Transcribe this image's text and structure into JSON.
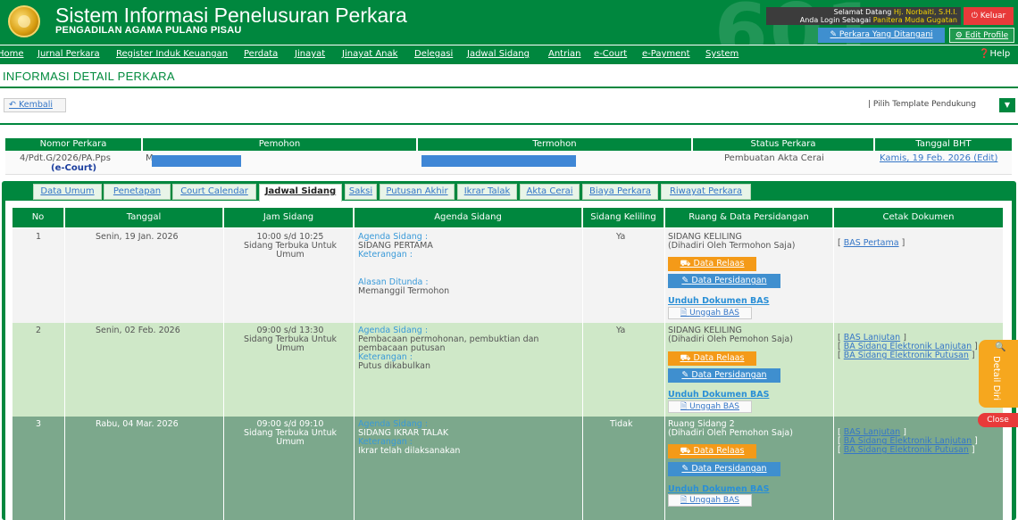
{
  "header": {
    "watermark": "601",
    "title": "Sistem Informasi Penelusuran Perkara",
    "subtitle": "PENGADILAN AGAMA PULANG PISAU",
    "greeting_prefix": "Selamat Datang",
    "user_name": "Hj. Norbaiti, S.H.I.",
    "login_prefix": "Anda Login Sebagai",
    "role": "Panitera Muda Gugatan",
    "logout_label": "Keluar",
    "handled_label": "Perkara Yang Ditangani",
    "edit_profile_label": "Edit Profile"
  },
  "nav": {
    "items": [
      "Home",
      "Jurnal Perkara",
      "Register Induk Keuangan",
      "Perdata",
      "Jinayat",
      "Jinayat Anak",
      "Delegasi",
      "Jadwal Sidang",
      "Antrian",
      "e-Court",
      "e-Payment",
      "System"
    ],
    "help": "Help"
  },
  "page": {
    "title": "INFORMASI DETAIL PERKARA",
    "back_label": "Kembali",
    "template_label": "Pilih Template Pendukung"
  },
  "summary": {
    "headers": [
      "Nomor Perkara",
      "Pemohon",
      "Termohon",
      "Status Perkara",
      "Tanggal BHT"
    ],
    "nomor": "4/Pdt.G/2026/PA.Pps",
    "ecourt": "(e-Court)",
    "pemohon_initial": "M",
    "status": "Pembuatan Akta Cerai",
    "bht": "Kamis, 19 Feb. 2026 (Edit)"
  },
  "tabs": [
    "Data Umum",
    "Penetapan",
    "Court Calendar",
    "Jadwal Sidang",
    "Saksi",
    "Putusan Akhir",
    "Ikrar Talak",
    "Akta Cerai",
    "Biaya Perkara",
    "Riwayat Perkara"
  ],
  "table": {
    "headers": [
      "No",
      "Tanggal",
      "Jam Sidang",
      "Agenda Sidang",
      "Sidang Keliling",
      "Ruang & Data Persidangan",
      "Cetak Dokumen"
    ],
    "agenda_label": "Agenda Sidang :",
    "keterangan_label": "Keterangan :",
    "alasan_label": "Alasan Ditunda :",
    "relaas_label": "Data Relaas",
    "persidangan_label": "Data Persidangan",
    "unduh_label": "Unduh Dokumen BAS",
    "unggah_label": "Unggah BAS",
    "rows": [
      {
        "no": "1",
        "tanggal": "Senin, 19 Jan. 2026",
        "jam": "10:00 s/d 10:25",
        "jam_note": "Sidang Terbuka Untuk Umum",
        "agenda": "SIDANG PERTAMA",
        "keterangan": "",
        "alasan": "Memanggil Termohon",
        "keliling": "Ya",
        "ruang": "SIDANG KELILING",
        "ruang_note": "(Dihadiri Oleh Termohon Saja)",
        "docs": [
          "BAS Pertama"
        ]
      },
      {
        "no": "2",
        "tanggal": "Senin, 02 Feb. 2026",
        "jam": "09:00 s/d 13:30",
        "jam_note": "Sidang Terbuka Untuk Umum",
        "agenda": "Pembacaan permohonan, pembuktian dan pembacaan putusan",
        "keterangan": "Putus dikabulkan",
        "keliling": "Ya",
        "ruang": "SIDANG KELILING",
        "ruang_note": "(Dihadiri Oleh Pemohon Saja)",
        "docs": [
          "BAS Lanjutan",
          "BA Sidang Elektronik Lanjutan",
          "BA Sidang Elektronik Putusan"
        ]
      },
      {
        "no": "3",
        "tanggal": "Rabu, 04 Mar. 2026",
        "jam": "09:00 s/d 09:10",
        "jam_note": "Sidang Terbuka Untuk Umum",
        "agenda": "SIDANG IKRAR TALAK",
        "keterangan": "Ikrar telah dilaksanakan",
        "keliling": "Tidak",
        "ruang": "Ruang Sidang 2",
        "ruang_note": "(Dihadiri Oleh Pemohon Saja)",
        "docs": [
          "BAS Lanjutan",
          "BA Sidang Elektronik Lanjutan",
          "BA Sidang Elektronik Putusan"
        ]
      }
    ]
  },
  "side": {
    "detail_label": "Detail Diri",
    "close_label": "Close"
  },
  "colors": {
    "primary": "#00873e",
    "row2": "#cfe8c8",
    "row3": "#7ca88c",
    "orange": "#f49a18",
    "blue": "#3f8fcf",
    "red": "#e83a3a"
  }
}
